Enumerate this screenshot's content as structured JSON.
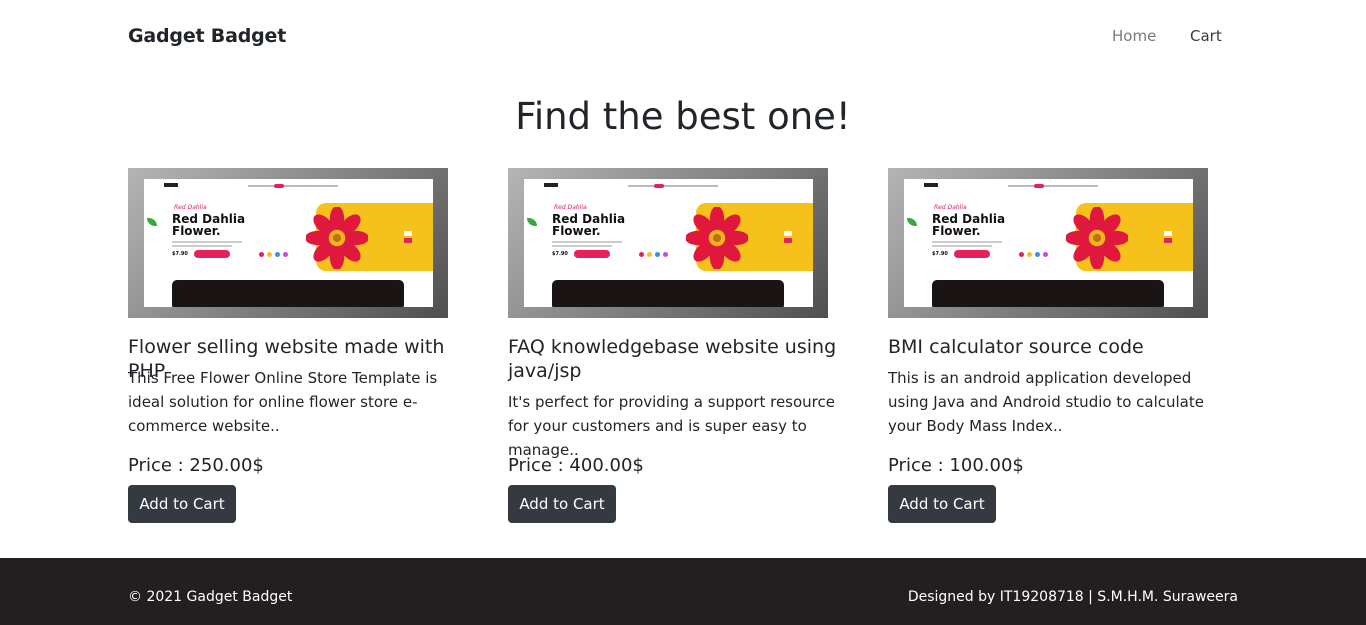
{
  "nav": {
    "brand": "Gadget Badget",
    "links": [
      "Home",
      "Cart"
    ]
  },
  "page": {
    "heading": "Find the best one!"
  },
  "thumbnail": {
    "script_text": "Red Dahlia",
    "title_line1": "Red Dahlia",
    "title_line2": "Flower.",
    "price": "$7.90"
  },
  "products": [
    {
      "title": "Flower selling website made with PHP",
      "description": "This Free Flower Online Store Template is ideal solution for online flower store e-commerce website..",
      "price": "Price : 250.00$",
      "button": "Add to Cart"
    },
    {
      "title": "FAQ knowledgebase website using java/jsp",
      "description": "It's perfect for providing a support resource for your customers and is super easy to manage..",
      "price": "Price : 400.00$",
      "button": "Add to Cart"
    },
    {
      "title": "BMI calculator source code",
      "description": "This is an android application developed using Java and Android studio to calculate your Body Mass Index..",
      "price": "Price : 100.00$",
      "button": "Add to Cart"
    }
  ],
  "footer": {
    "copyright": "© 2021 Gadget Badget",
    "credit": "Designed by IT19208718 | S.M.H.M. Suraweera"
  },
  "colors": {
    "button_bg": "#343a40",
    "footer_bg": "#231f20",
    "accent_pink": "#e6205a",
    "accent_yellow": "#f7c11b"
  }
}
